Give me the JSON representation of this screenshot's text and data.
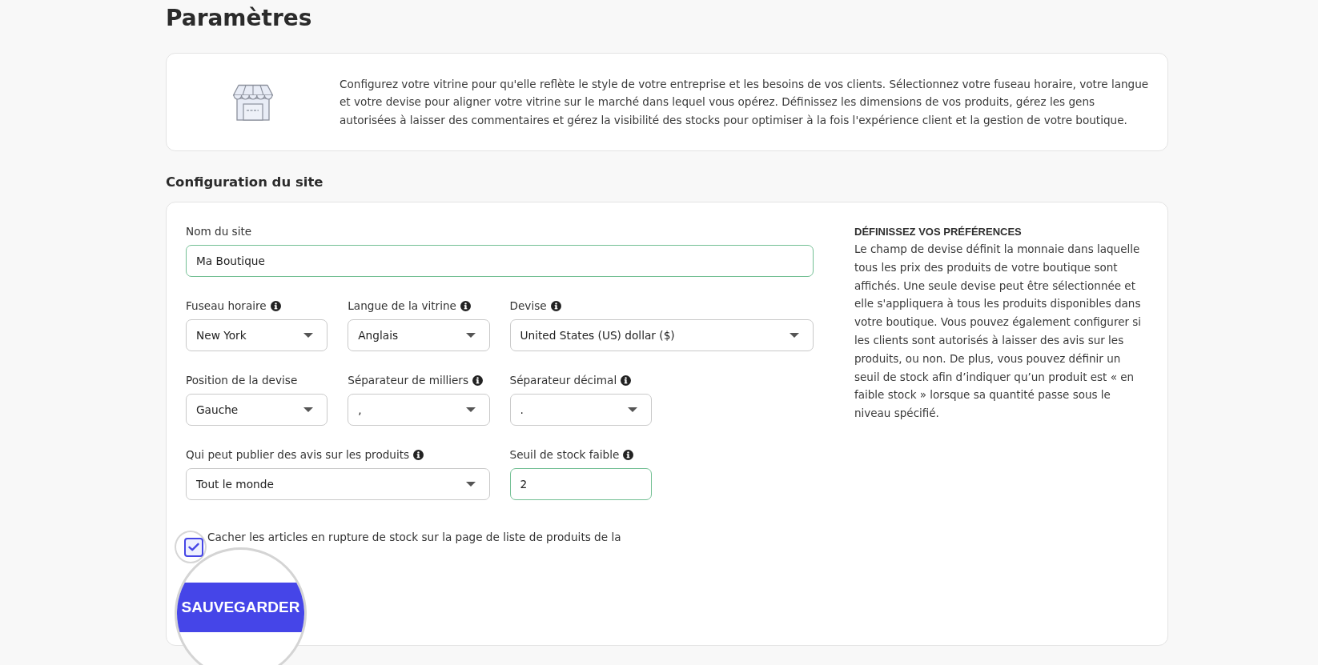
{
  "page": {
    "title": "Paramètres"
  },
  "intro": {
    "text": "Configurez votre vitrine pour qu'elle reflète le style de votre entreprise et les besoins de vos clients. Sélectionnez votre fuseau horaire, votre langue et votre devise pour aligner votre vitrine sur le marché dans lequel vous opérez. Définissez les dimensions de vos produits, gérez les gens autorisées à laisser des commentaires et gérez la visibilité des stocks pour optimiser à la fois l'expérience client et la gestion de votre boutique."
  },
  "site_config": {
    "title": "Configuration du site",
    "fields": [
      {
        "kind": "text",
        "label": "Nom du site",
        "info": false,
        "value": "Ma Boutique"
      },
      {
        "kind": "select",
        "label": "Fuseau horaire",
        "info": true,
        "value": "New York"
      },
      {
        "kind": "select",
        "label": "Langue de la vitrine",
        "info": true,
        "value": "Anglais"
      },
      {
        "kind": "select",
        "label": "Devise",
        "info": true,
        "value": "United States (US) dollar ($)"
      },
      {
        "kind": "select",
        "label": "Position de la devise",
        "info": false,
        "value": "Gauche"
      },
      {
        "kind": "select",
        "label": "Séparateur de milliers",
        "info": true,
        "value": ","
      },
      {
        "kind": "select",
        "label": "Séparateur décimal",
        "info": true,
        "value": "."
      },
      {
        "kind": "select",
        "label": "Qui peut publier des avis sur les produits",
        "info": true,
        "value": "Tout le monde"
      },
      {
        "kind": "text",
        "label": "Seuil de stock faible",
        "info": true,
        "value": "2"
      }
    ],
    "checkbox": {
      "label": "Cacher les articles en rupture de stock sur la page de liste de produits de la",
      "checked": true
    },
    "save_button": {
      "label": "SAUVEGARDER"
    },
    "help": {
      "heading": "DÉFINISSEZ VOS PRÉFÉRENCES",
      "text": "Le champ de devise définit la monnaie dans laquelle tous les prix des produits de votre boutique sont affichés. Une seule devise peut être sélectionnée et elle s'appliquera à tous les produits disponibles dans votre boutique. Vous pouvez également configurer si les clients sont autorisés à laisser des avis sur les produits, ou non. De plus, vous pouvez définir un seuil de stock afin d’indiquer qu’un produit est « en faible stock » lorsque sa quantité passe sous le niveau spécifié."
    }
  }
}
